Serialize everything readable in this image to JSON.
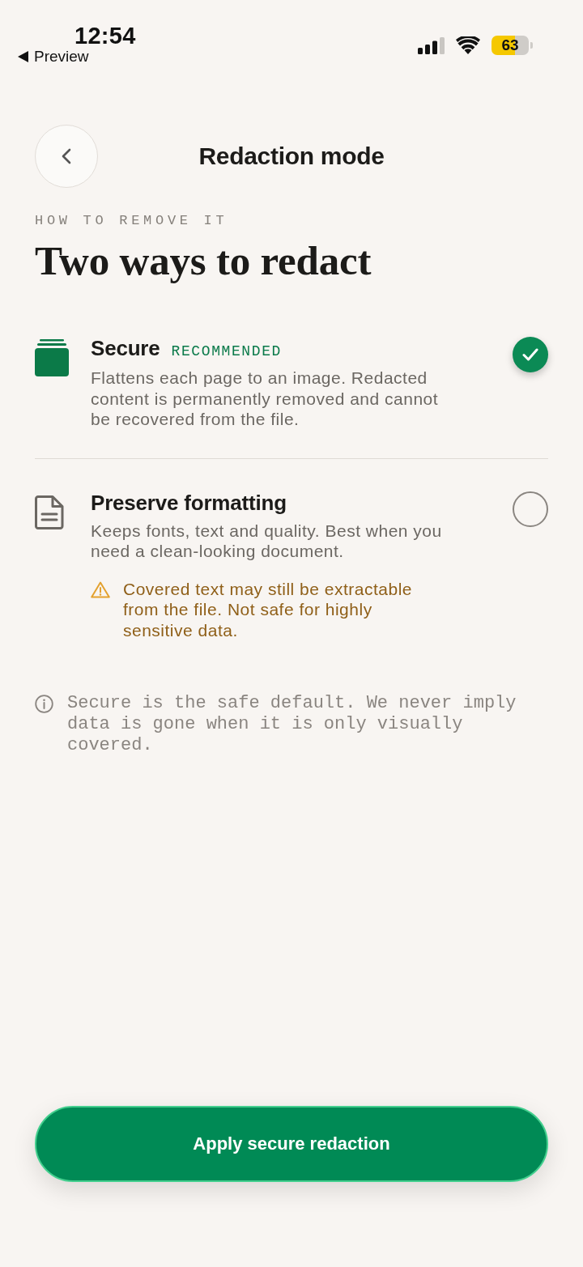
{
  "status_bar": {
    "time": "12:54",
    "back_label": "Preview",
    "battery": "63"
  },
  "header": {
    "title": "Redaction mode"
  },
  "intro": {
    "eyebrow": "HOW TO REMOVE IT",
    "heading": "Two ways to redact"
  },
  "options": [
    {
      "kind": "secure",
      "title": "Secure",
      "badge": "RECOMMENDED",
      "description": "Flattens each page to an image. Redacted content is permanently removed and cannot be recovered from the file.",
      "selected": true
    },
    {
      "kind": "preserve",
      "title": "Preserve formatting",
      "description": "Keeps fonts, text and quality. Best when you need a clean-looking document.",
      "warning": "Covered text may still be extractable from the file. Not safe for highly sensitive data.",
      "selected": false
    }
  ],
  "note": "Secure is the safe default. We never imply data is gone when it is only visually covered.",
  "primary_button": {
    "label": "Apply secure redaction"
  }
}
